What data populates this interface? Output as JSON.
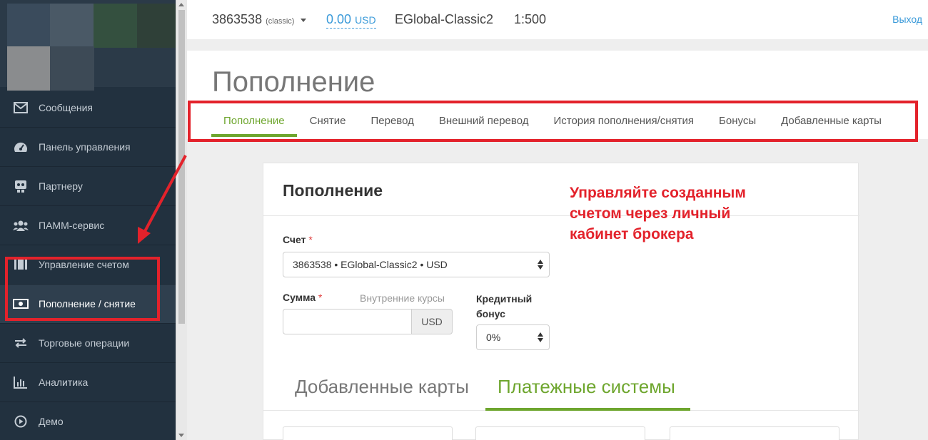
{
  "topbar": {
    "account_number": "3863538",
    "account_type": "(classic)",
    "balance_value": "0.00",
    "balance_currency": "USD",
    "server": "EGlobal-Classic2",
    "leverage": "1:500",
    "logout": "Выход"
  },
  "sidebar": {
    "items": [
      {
        "label": "Сообщения",
        "icon": "envelope-icon"
      },
      {
        "label": "Панель управления",
        "icon": "dashboard-icon"
      },
      {
        "label": "Партнеру",
        "icon": "partner-icon"
      },
      {
        "label": "ПАММ-сервис",
        "icon": "users-icon"
      },
      {
        "label": "Управление счетом",
        "icon": "account-icon"
      },
      {
        "label": "Пополнение / снятие",
        "icon": "money-icon",
        "active": true
      },
      {
        "label": "Торговые операции",
        "icon": "exchange-icon"
      },
      {
        "label": "Аналитика",
        "icon": "chart-icon"
      },
      {
        "label": "Демо",
        "icon": "play-icon"
      }
    ]
  },
  "page": {
    "title": "Пополнение",
    "tabs": [
      {
        "label": "Пополнение",
        "active": true
      },
      {
        "label": "Снятие"
      },
      {
        "label": "Перевод"
      },
      {
        "label": "Внешний перевод"
      },
      {
        "label": "История пополнения/снятия"
      },
      {
        "label": "Бонусы"
      },
      {
        "label": "Добавленные карты"
      }
    ]
  },
  "form": {
    "title": "Пополнение",
    "account_label": "Счет",
    "required_mark": "*",
    "account_value": "3863538 • EGlobal-Classic2 • USD",
    "amount_label": "Сумма",
    "rates_link": "Внутренние курсы",
    "amount_value": "",
    "amount_currency": "USD",
    "bonus_label_line1": "Кредитный",
    "bonus_label_line2": "бонус",
    "bonus_value": "0%",
    "pay_tabs": [
      {
        "label": "Добавленные карты"
      },
      {
        "label": "Платежные системы",
        "active": true
      }
    ]
  },
  "annotation": {
    "line1": "Управляйте созданным",
    "line2": "счетом через личный",
    "line3": "кабинет брокера",
    "color": "#e3222b"
  },
  "colors": {
    "sidebar_bg": "#22313f",
    "accent_green": "#6ea62e",
    "link_blue": "#3a9ad9"
  }
}
